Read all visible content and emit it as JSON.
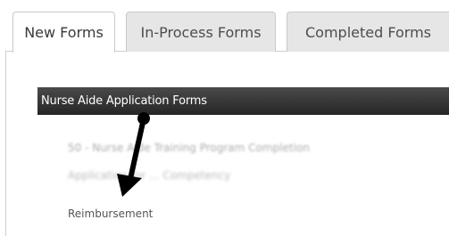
{
  "tabs": [
    {
      "label": "New Forms",
      "active": true
    },
    {
      "label": "In-Process Forms",
      "active": false
    },
    {
      "label": "Completed Forms",
      "active": false
    }
  ],
  "section": {
    "title": "Nurse Aide Application Forms",
    "items": [
      {
        "label": "50 - Nurse Aide Training Program Completion",
        "legible": false
      },
      {
        "label": "Application for ... Competency",
        "legible": false
      },
      {
        "label": "Reimbursement",
        "legible": true
      }
    ]
  },
  "colors": {
    "header_bg": "#2e2e2e",
    "header_text": "#ffffff",
    "inactive_tab_bg": "#e6e6e6",
    "arrow": "#000000"
  }
}
